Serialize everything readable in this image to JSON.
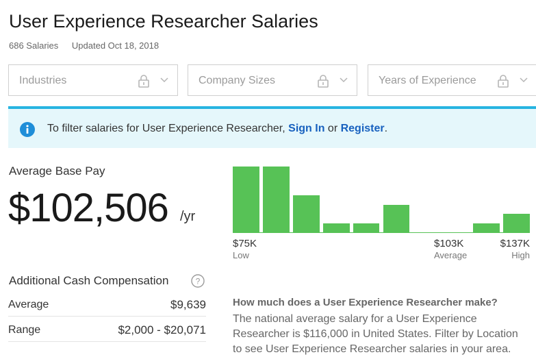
{
  "page": {
    "title": "User Experience Researcher Salaries",
    "salary_count": "686 Salaries",
    "updated": "Updated Oct 18, 2018"
  },
  "filters": [
    {
      "label": "Industries",
      "icon": "lock-icon",
      "caret": "chevron-down-icon"
    },
    {
      "label": "Company Sizes",
      "icon": "lock-icon",
      "caret": "chevron-down-icon"
    },
    {
      "label": "Years of Experience",
      "icon": "lock-icon",
      "caret": "chevron-down-icon"
    }
  ],
  "info_banner": {
    "icon": "info-icon",
    "prefix": "To filter salaries for User Experience Researcher, ",
    "sign_in": "Sign In",
    "middle": " or ",
    "register": "Register",
    "suffix": ".",
    "accent": "#27b4e1",
    "background": "#e5f7fb",
    "link_color": "#1861bf"
  },
  "pay": {
    "label": "Average Base Pay",
    "value": "$102,506",
    "unit": "/yr"
  },
  "histogram": {
    "bar_color": "#57c256",
    "relative_counts": [
      0.97,
      0.97,
      0.55,
      0.14,
      0.14,
      0.41,
      0.01,
      0.01,
      0.14,
      0.28
    ],
    "ticks": [
      {
        "value": "$75K",
        "caption": "Low"
      },
      {
        "value": "$103K",
        "caption": "Average"
      },
      {
        "value": "$137K",
        "caption": "High"
      }
    ]
  },
  "additional": {
    "title": "Additional Cash Compensation",
    "help_icon": "question-icon",
    "rows": [
      {
        "key": "Average",
        "value": "$9,639"
      },
      {
        "key": "Range",
        "value": "$2,000 - $20,071"
      }
    ]
  },
  "faq": {
    "question": "How much does a User Experience Researcher make?",
    "answer": "The national average salary for a User Experience Researcher is $116,000 in United States. Filter by Location to see User Experience Researcher salaries in your area."
  }
}
